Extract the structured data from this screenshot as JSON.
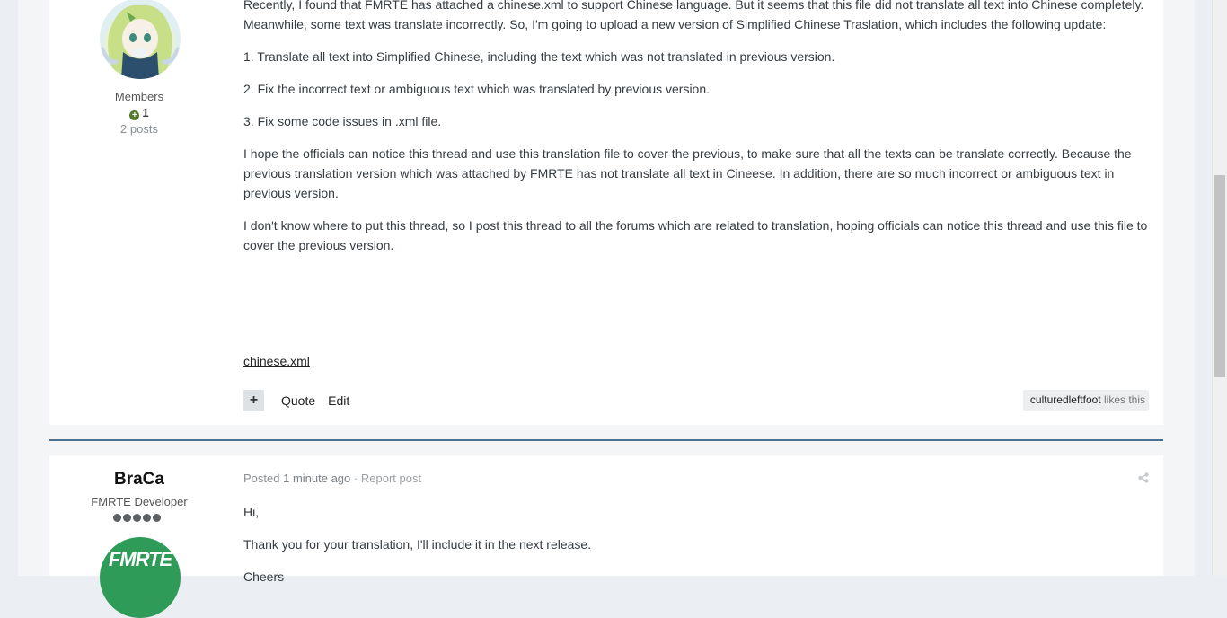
{
  "post1": {
    "author": {
      "group": "Members",
      "reputation": "1",
      "post_count": "2 posts"
    },
    "paragraphs": [
      "Recently, I found that FMRTE has attached a chinese.xml to support Chinese language. But it seems that this file did not translate all text into Chinese completely. Meanwhile, some text was translate incorrectly. So, I'm going to upload a new version of Simplified Chinese Traslation, which includes the following update:",
      "1. Translate all text into Simplified Chinese, including the text which was not translated in previous version.",
      "2. Fix the incorrect text or ambiguous text which was translated by previous version.",
      "3. Fix some code issues in .xml file.",
      "I hope the officials can notice this thread and use this translation file to cover the previous, to make sure that all the texts can be translate correctly. Because the previous translation version which was attached by FMRTE has not translate all text in Cineese. In addition, there are so much incorrect or ambiguous text in previous version.",
      "I don't know where to put this thread, so I post this thread to all the forums which are related to translation, hoping officials can notice this thread and use this file to cover the previous version."
    ],
    "attachment": "chinese.xml",
    "controls": {
      "multiquote": "+",
      "quote": "Quote",
      "edit": "Edit"
    },
    "likes": {
      "liker": "culturedleftfoot",
      "suffix": "likes this"
    }
  },
  "post2": {
    "author": {
      "name": "BraCa",
      "title": "FMRTE Developer",
      "avatar_text": "FMRTE"
    },
    "meta": {
      "posted_label": "Posted",
      "time": "1 minute ago",
      "separator": "·",
      "report": "Report post"
    },
    "paragraphs": [
      "Hi,",
      "Thank you for your translation, I'll include it in the next release.",
      "Cheers"
    ]
  },
  "colors": {
    "separator": "#4b6f8f",
    "reputation_positive": "#53772d",
    "avatar_green": "#2e9c58"
  }
}
